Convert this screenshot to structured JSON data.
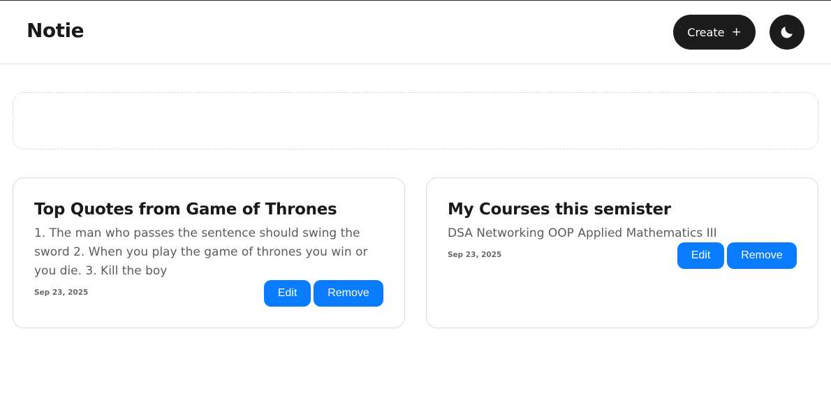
{
  "header": {
    "logo": "Notie",
    "create_label": "Create",
    "create_icon": "+",
    "theme_icon": "moon-icon"
  },
  "notes": [
    {
      "title": "Top Quotes from Game of Thrones",
      "body": "1. The man who passes the sentence should swing the sword 2. When you play the game of thrones you win or you die. 3. Kill the boy",
      "date": "Sep 23, 2025",
      "edit_label": "Edit",
      "remove_label": "Remove"
    },
    {
      "title": "My Courses this semister",
      "body": "DSA Networking OOP Applied Mathematics III",
      "date": "Sep 23, 2025",
      "edit_label": "Edit",
      "remove_label": "Remove"
    }
  ],
  "colors": {
    "accent": "#0a7cff",
    "dark": "#1c1c1c",
    "border": "#dcdcdc"
  }
}
